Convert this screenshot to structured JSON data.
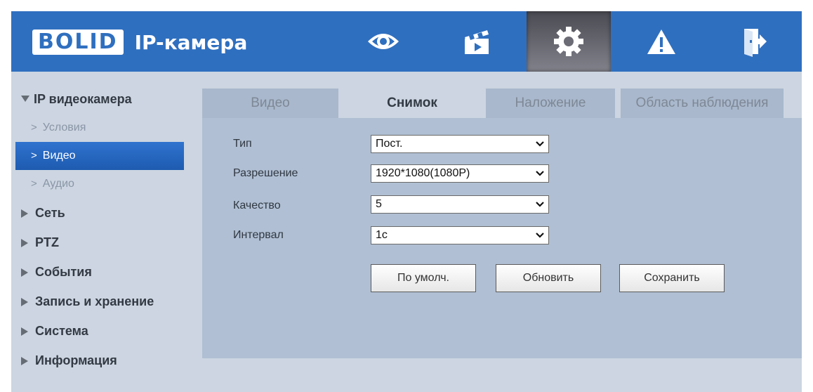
{
  "header": {
    "brand": "BOLID",
    "product": "IP-камера",
    "nav": [
      {
        "icon": "eye-icon"
      },
      {
        "icon": "clapperboard-icon"
      },
      {
        "icon": "gear-icon",
        "active": true
      },
      {
        "icon": "warning-icon"
      },
      {
        "icon": "logout-icon"
      }
    ],
    "accent_color": "#2f6fbf"
  },
  "sidebar": {
    "items": [
      {
        "label": "IP видеокамера",
        "expanded": true,
        "children": [
          {
            "label": "Условия"
          },
          {
            "label": "Видео",
            "active": true
          },
          {
            "label": "Аудио"
          }
        ]
      },
      {
        "label": "Сеть"
      },
      {
        "label": "PTZ"
      },
      {
        "label": "События"
      },
      {
        "label": "Запись и хранение"
      },
      {
        "label": "Система"
      },
      {
        "label": "Информация"
      }
    ]
  },
  "tabs": [
    {
      "label": "Видео"
    },
    {
      "label": "Снимок",
      "active": true
    },
    {
      "label": "Наложение"
    },
    {
      "label": "Область наблюдения"
    }
  ],
  "form": {
    "fields": [
      {
        "label": "Тип",
        "value": "Пост."
      },
      {
        "label": "Разрешение",
        "value": "1920*1080(1080P)"
      },
      {
        "label": "Качество",
        "value": "5"
      },
      {
        "label": "Интервал",
        "value": "1с"
      }
    ],
    "buttons": {
      "default": "По умолч.",
      "refresh": "Обновить",
      "save": "Сохранить"
    }
  }
}
